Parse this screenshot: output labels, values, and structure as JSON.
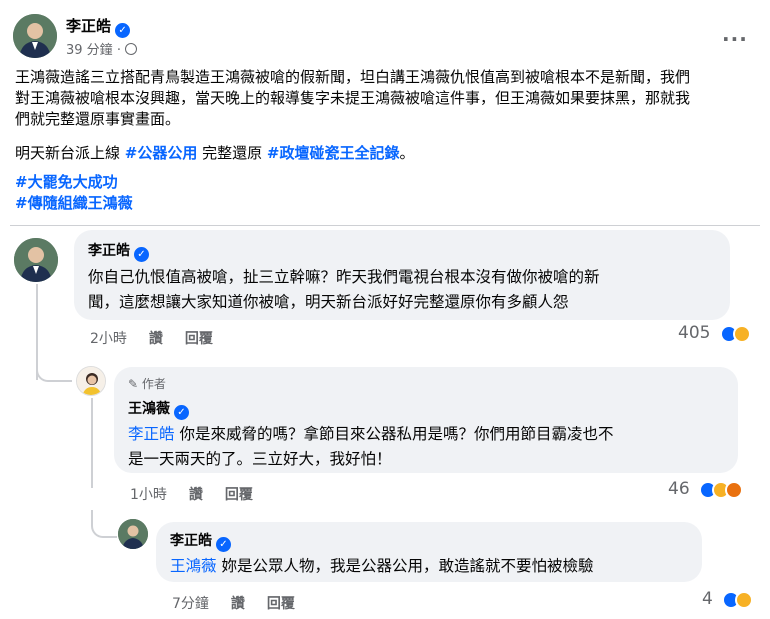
{
  "post": {
    "author": "李正皓",
    "time": "39 分鐘",
    "separator": "·",
    "more_icon": "...",
    "text_lines": [
      "王鴻薇造謠三立搭配青鳥製造王鴻薇被嗆的假新聞，坦白講王鴻薇仇恨值高到被嗆根本不是新聞，我們",
      "對王鴻薇被嗆根本沒興趣，當天晚上的報導隻字未提王鴻薇被嗆這件事，但王鴻薇如果要抹黑，那就我",
      "們就完整還原事實畫面。"
    ],
    "line2_prefix": "明天新台派上線 ",
    "line2_tag1": "#公器公用",
    "line2_middle": " 完整還原 ",
    "line2_tag2": "#政壇碰瓷王全記錄",
    "line2_suffix": "。",
    "tag3": "#大罷免大成功",
    "tag4": "#傳隨組織王鴻薇"
  },
  "comments": [
    {
      "author": "李正皓",
      "lines": [
        "你自己仇恨值高被嗆，扯三立幹嘛？昨天我們電視台根本沒有做你被嗆的新",
        "聞，這麼想讓大家知道你被嗆，明天新台派好好完整還原你有多顧人怨"
      ],
      "time": "2小時",
      "like": "讚",
      "reply": "回覆",
      "reactions": "405"
    },
    {
      "badge": "作者",
      "author": "王鴻薇",
      "mention": "李正皓",
      "line1_rest": " 你是來威脅的嗎？拿節目來公器私用是嗎？你們用節目霸凌也不",
      "line2": "是一天兩天的了。三立好大，我好怕！",
      "time": "1小時",
      "like": "讚",
      "reply": "回覆",
      "reactions": "46"
    },
    {
      "author": "李正皓",
      "mention": "王鴻薇",
      "rest": " 妳是公眾人物，我是公器公用，敢造謠就不要怕被檢驗",
      "time": "7分鐘",
      "like": "讚",
      "reply": "回覆",
      "reactions": "4"
    }
  ],
  "colors": {
    "accent": "#0866ff",
    "bubble": "#f0f2f5",
    "secondary_text": "#65676b"
  }
}
